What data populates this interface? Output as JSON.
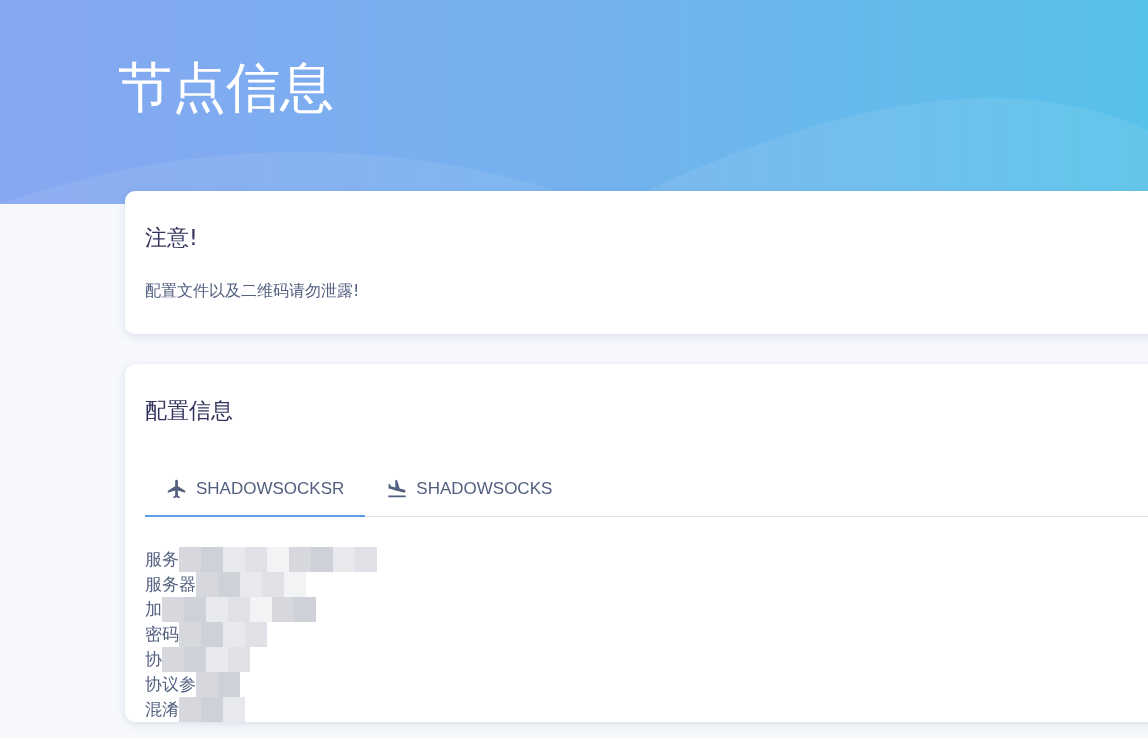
{
  "header": {
    "title": "节点信息"
  },
  "notice_card": {
    "title": "注意!",
    "text": "配置文件以及二维码请勿泄露!"
  },
  "config_card": {
    "title": "配置信息",
    "tabs": [
      {
        "label": "SHADOWSOCKSR",
        "selected": true
      },
      {
        "label": "SHADOWSOCKS",
        "selected": false
      }
    ],
    "lines": [
      {
        "label": "服务"
      },
      {
        "label": "服务器"
      },
      {
        "label": "加"
      },
      {
        "label": "密码"
      },
      {
        "label": "协"
      },
      {
        "label": "协议参"
      },
      {
        "label": "混淆"
      }
    ]
  }
}
